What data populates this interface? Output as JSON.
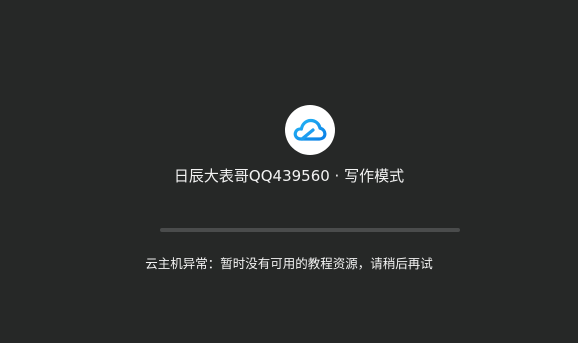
{
  "app": {
    "logo_icon": "cloud-icon",
    "title": "日辰大表哥QQ439560 · 写作模式"
  },
  "progress": {
    "value": 1.0
  },
  "status": {
    "message": "云主机异常：暂时没有可用的教程资源，请稍后再试"
  },
  "colors": {
    "background": "#262827",
    "text": "#f2f2f2",
    "logo_bg": "#ffffff",
    "cloud_blue": "#1c9ef0",
    "progress_track": "#3c3e3e"
  }
}
